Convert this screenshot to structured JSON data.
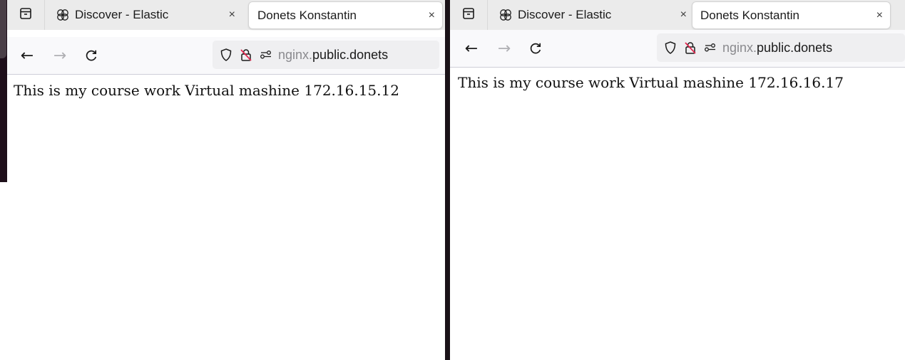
{
  "windows": [
    {
      "tabs": [
        {
          "label": "Discover - Elastic",
          "icon": "elastic-icon",
          "close_label": "×"
        },
        {
          "label": "Donets Konstantin",
          "close_label": "×",
          "active": true
        }
      ],
      "nav": {
        "back": "←",
        "forward": "→",
        "reload": "C"
      },
      "url": {
        "prefix": "nginx.",
        "host": "public.donets"
      },
      "page_text": "This is my course work Virtual mashine 172.16.15.12"
    },
    {
      "tabs": [
        {
          "label": "Discover - Elastic",
          "icon": "elastic-icon",
          "close_label": "×"
        },
        {
          "label": "Donets Konstantin",
          "close_label": "×",
          "active": true
        }
      ],
      "nav": {
        "back": "←",
        "forward": "→",
        "reload": "C"
      },
      "url": {
        "prefix": "nginx.",
        "host": "public.donets"
      },
      "page_text": "This is my course work Virtual mashine 172.16.16.17"
    }
  ],
  "colors": {
    "tabbar_bg": "#ebebeb",
    "toolbar_bg": "#f9f9fb",
    "urlbar_bg": "#efeff1",
    "desktop_bg": "#1e0f1a",
    "blocked_red": "#e22850"
  }
}
